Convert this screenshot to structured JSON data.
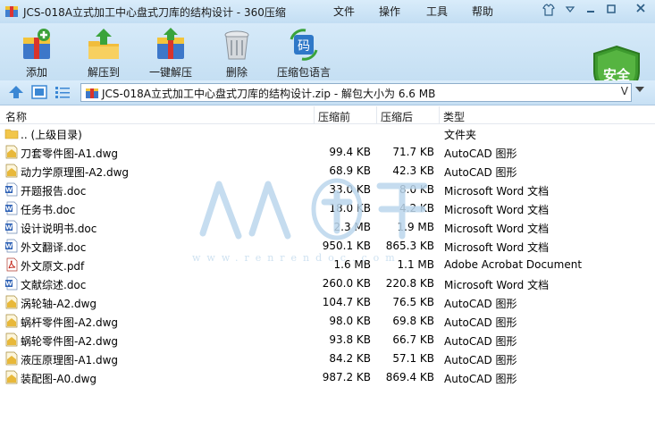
{
  "window": {
    "title": "JCS-018A立式加工中心盘式刀库的结构设计 - 360压缩",
    "menu": [
      "文件",
      "操作",
      "工具",
      "帮助"
    ],
    "controls": [
      "shirt-icon",
      "dropdown-icon",
      "minimize-icon",
      "maximize-icon",
      "close-icon"
    ]
  },
  "toolbar": {
    "items": [
      {
        "label": "添加",
        "icon": "add-archive-icon"
      },
      {
        "label": "解压到",
        "icon": "extract-to-icon"
      },
      {
        "label": "一键解压",
        "icon": "one-click-extract-icon"
      },
      {
        "label": "删除",
        "icon": "delete-icon"
      },
      {
        "label": "压缩包语言",
        "icon": "archive-language-icon"
      }
    ],
    "security_badge": "安全",
    "lang_icon_text": "码"
  },
  "address": {
    "path": "JCS-018A立式加工中心盘式刀库的结构设计.zip - 解包大小为 6.6 MB",
    "dropdown_glyph": "V"
  },
  "columns": [
    "名称",
    "压缩前",
    "压缩后",
    "类型"
  ],
  "files": [
    {
      "name": ".. (上级目录)",
      "size": "",
      "packed": "",
      "type": "文件夹",
      "icon": "folder-icon"
    },
    {
      "name": "刀套零件图-A1.dwg",
      "size": "99.4 KB",
      "packed": "71.7 KB",
      "type": "AutoCAD 图形",
      "icon": "dwg-file-icon"
    },
    {
      "name": "动力学原理图-A2.dwg",
      "size": "68.9 KB",
      "packed": "42.3 KB",
      "type": "AutoCAD 图形",
      "icon": "dwg-file-icon"
    },
    {
      "name": "开题报告.doc",
      "size": "33.0 KB",
      "packed": "8.0 KB",
      "type": "Microsoft Word 文档",
      "icon": "word-file-icon"
    },
    {
      "name": "任务书.doc",
      "size": "18.0 KB",
      "packed": "4.2 KB",
      "type": "Microsoft Word 文档",
      "icon": "word-file-icon"
    },
    {
      "name": "设计说明书.doc",
      "size": "2.3 MB",
      "packed": "1.9 MB",
      "type": "Microsoft Word 文档",
      "icon": "word-file-icon"
    },
    {
      "name": "外文翻译.doc",
      "size": "950.1 KB",
      "packed": "865.3 KB",
      "type": "Microsoft Word 文档",
      "icon": "word-file-icon"
    },
    {
      "name": "外文原文.pdf",
      "size": "1.6 MB",
      "packed": "1.1 MB",
      "type": "Adobe Acrobat Document",
      "icon": "pdf-file-icon"
    },
    {
      "name": "文献综述.doc",
      "size": "260.0 KB",
      "packed": "220.8 KB",
      "type": "Microsoft Word 文档",
      "icon": "word-file-icon"
    },
    {
      "name": "涡轮轴-A2.dwg",
      "size": "104.7 KB",
      "packed": "76.5 KB",
      "type": "AutoCAD 图形",
      "icon": "dwg-file-icon"
    },
    {
      "name": "蜗杆零件图-A2.dwg",
      "size": "98.0 KB",
      "packed": "69.8 KB",
      "type": "AutoCAD 图形",
      "icon": "dwg-file-icon"
    },
    {
      "name": "蜗轮零件图-A2.dwg",
      "size": "93.8 KB",
      "packed": "66.7 KB",
      "type": "AutoCAD 图形",
      "icon": "dwg-file-icon"
    },
    {
      "name": "液压原理图-A1.dwg",
      "size": "84.2 KB",
      "packed": "57.1 KB",
      "type": "AutoCAD 图形",
      "icon": "dwg-file-icon"
    },
    {
      "name": "装配图-A0.dwg",
      "size": "987.2 KB",
      "packed": "869.4 KB",
      "type": "AutoCAD 图形",
      "icon": "dwg-file-icon"
    }
  ],
  "watermark": {
    "text": "人人文库",
    "url": "www.renrendoc.com"
  },
  "colors": {
    "chrome": "#c7e0f4",
    "shield": "#3d9a2e",
    "word": "#2b5fb4",
    "pdf": "#c62a1d",
    "folder": "#f2c64a"
  }
}
